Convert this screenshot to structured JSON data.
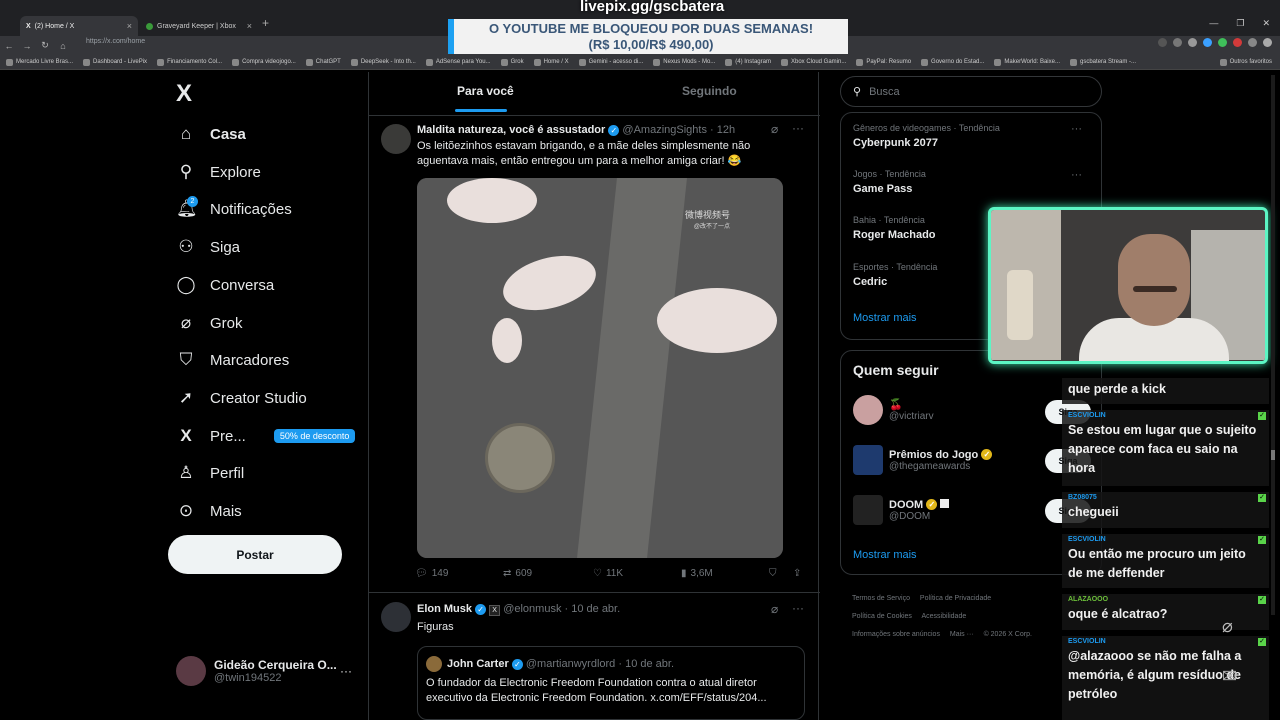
{
  "browser": {
    "tabs": [
      {
        "label": "(2) Home / X",
        "active": true
      },
      {
        "label": "Graveyard Keeper | Xbox",
        "active": false
      }
    ],
    "url": "https://x.com/home",
    "bookmarks": [
      "Mercado Livre Bras...",
      "Dashboard - LivePix",
      "Financiamento Col...",
      "Compra videojogo...",
      "ChatGPT",
      "DeepSeek - Into th...",
      "AdSense para You...",
      "Grok",
      "Home / X",
      "Gemini - acesso di...",
      "Nexus Mods - Mo...",
      "(4) Instagram",
      "Xbox Cloud Gamin...",
      "PayPal: Resumo",
      "Governo do Estad...",
      "MakerWorld: Baixe...",
      "gscbatera Stream -..."
    ],
    "bookmarks_other": "Outros favoritos"
  },
  "overlay": {
    "top_text": "livepix.gg/gscbatera",
    "banner_line1": "O YOUTUBE ME BLOQUEOU POR DUAS SEMANAS!",
    "banner_line2": "(R$ 10,00/R$ 490,00)"
  },
  "nav": {
    "logo": "X",
    "items": [
      {
        "label": "Casa",
        "icon": "home-icon"
      },
      {
        "label": "Explore",
        "icon": "search-icon"
      },
      {
        "label": "Notificações",
        "icon": "bell-icon",
        "badge_count": "2"
      },
      {
        "label": "Siga",
        "icon": "add-user-icon"
      },
      {
        "label": "Conversa",
        "icon": "chat-bubble-icon"
      },
      {
        "label": "Grok",
        "icon": "grok-icon"
      },
      {
        "label": "Marcadores",
        "icon": "bookmark-icon"
      },
      {
        "label": "Creator Studio",
        "icon": "rocket-icon"
      },
      {
        "label": "Pre...",
        "icon": "x-icon"
      },
      {
        "label": "Perfil",
        "icon": "person-icon"
      },
      {
        "label": "Mais",
        "icon": "more-circle-icon"
      }
    ],
    "premium_badge": "50% de desconto",
    "post_button": "Postar",
    "profile_name": "Gideão Cerqueira O...",
    "profile_handle": "@twin194522"
  },
  "feed": {
    "tab_for_you": "Para você",
    "tab_following": "Seguindo",
    "tweet1": {
      "name": "Maldita natureza, você é assustador",
      "handle": "@AmazingSights",
      "time": "· 12h",
      "text": "Os leitõezinhos estavam brigando, e a mãe deles simplesmente não aguentava mais, então entregou um para a melhor amiga criar! 😂",
      "watermark": "微博视频号",
      "watermark2": "@改不了一点",
      "replies": "149",
      "reposts": "609",
      "likes": "11K",
      "views": "3,6M"
    },
    "tweet2": {
      "name": "Elon Musk",
      "handle": "@elonmusk",
      "time": "· 10 de abr.",
      "text": "Figuras",
      "quote_name": "John Carter",
      "quote_handle": "@martianwyrdlord",
      "quote_time": "· 10 de abr.",
      "quote_text": "O fundador da Electronic Freedom Foundation contra o atual diretor executivo da Electronic Freedom Foundation.  x.com/EFF/status/204..."
    }
  },
  "sidebar": {
    "search_placeholder": "Busca",
    "trends": [
      {
        "category": "Gêneros de videogames · Tendência",
        "name": "Cyberpunk 2077"
      },
      {
        "category": "Jogos · Tendência",
        "name": "Game Pass"
      },
      {
        "category": "Bahia · Tendência",
        "name": "Roger Machado"
      },
      {
        "category": "Esportes · Tendência",
        "name": "Cedric"
      }
    ],
    "show_more": "Mostrar mais",
    "who_to_follow": "Quem seguir",
    "follow": [
      {
        "name": "🍒",
        "handle": "@victriarv",
        "button": "Siga"
      },
      {
        "name": "Prêmios do Jogo",
        "handle": "@thegameawards",
        "button": "Siga"
      },
      {
        "name": "DOOM",
        "handle": "@DOOM",
        "button": "Siga"
      }
    ],
    "show_more2": "Mostrar mais",
    "footer": [
      "Termos de Serviço",
      "Política de Privacidade",
      "Política de Cookies",
      "Acessibilidade",
      "Informações sobre anúncios",
      "Mais ···",
      "© 2026 X Corp."
    ]
  },
  "chat": [
    {
      "user": "",
      "text": "que perde a kick"
    },
    {
      "user": "ESCVIOLIN",
      "text": "Se estou em lugar que o sujeito aparece com faca eu saio na hora"
    },
    {
      "user": "BZ08075",
      "text": "chegueii"
    },
    {
      "user": "ESCVIOLIN",
      "text": "Ou então me procuro um jeito de me deffender"
    },
    {
      "user": "ALAZAOOO",
      "text": "oque é alcatrao?"
    },
    {
      "user": "ESCVIOLIN",
      "text": "@alazaooo se não me falha a memória, é algum resíduo de petróleo"
    }
  ],
  "colors": {
    "accent": "#1d9bf0",
    "webcam_border": "#5cf5c4",
    "background": "#000000"
  }
}
